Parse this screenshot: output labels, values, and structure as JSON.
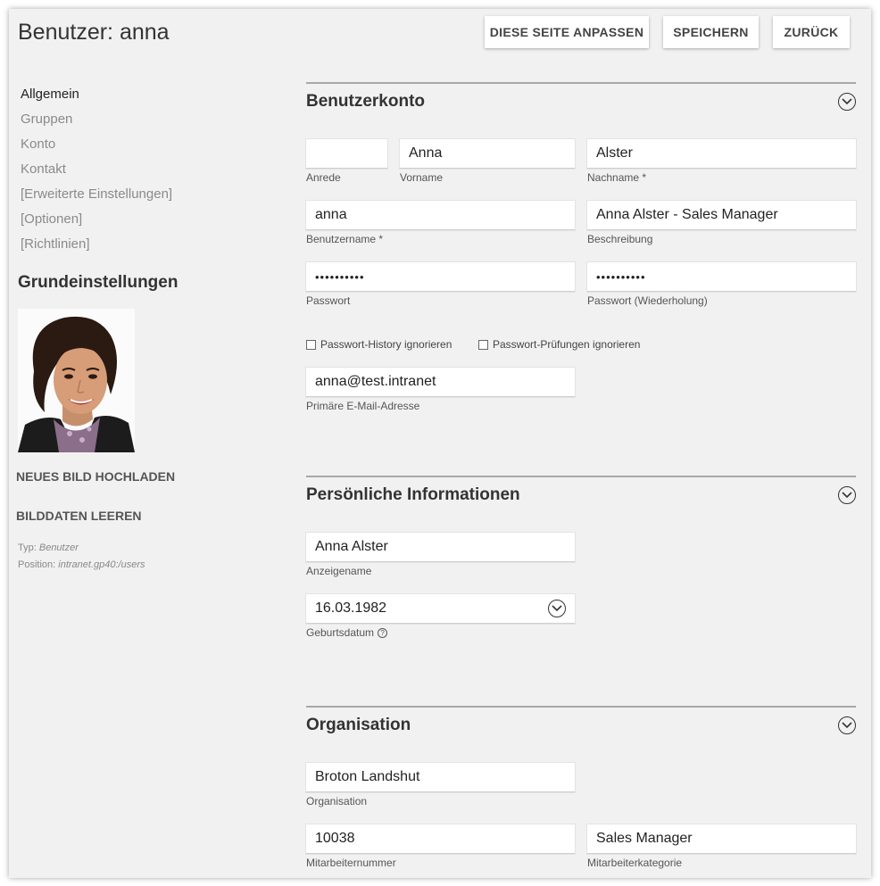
{
  "header": {
    "title": "Benutzer: anna",
    "buttons": {
      "customize": "Diese Seite anpassen",
      "save": "Speichern",
      "back": "Zurück"
    }
  },
  "sidebar": {
    "items": [
      {
        "label": "Allgemein",
        "active": true
      },
      {
        "label": "Gruppen"
      },
      {
        "label": "Konto"
      },
      {
        "label": "Kontakt"
      },
      {
        "label": "[Erweiterte Einstellungen]"
      },
      {
        "label": "[Optionen]"
      },
      {
        "label": "[Richtlinien]"
      }
    ],
    "section_title": "Grundeinstellungen",
    "upload_label": "Neues Bild hochladen",
    "clear_label": "Bilddaten leeren",
    "type_label": "Typ:",
    "type_value": "Benutzer",
    "position_label": "Position:",
    "position_value": "intranet.gp40:/users"
  },
  "account": {
    "title": "Benutzerkonto",
    "salutation": {
      "value": "",
      "label": "Anrede"
    },
    "first_name": {
      "value": "Anna",
      "label": "Vorname"
    },
    "last_name": {
      "value": "Alster",
      "label": "Nachname *"
    },
    "username": {
      "value": "anna",
      "label": "Benutzername *"
    },
    "description": {
      "value": "Anna Alster - Sales Manager",
      "label": "Beschreibung"
    },
    "password": {
      "value": "••••••••••",
      "label": "Passwort"
    },
    "password_repeat": {
      "value": "••••••••••",
      "label": "Passwort (Wiederholung)"
    },
    "ignore_history": "Passwort-History ignorieren",
    "ignore_checks": "Passwort-Prüfungen ignorieren",
    "email": {
      "value": "anna@test.intranet",
      "label": "Primäre E-Mail-Adresse"
    }
  },
  "personal": {
    "title": "Persönliche Informationen",
    "display_name": {
      "value": "Anna Alster",
      "label": "Anzeigename"
    },
    "birthdate": {
      "value": "16.03.1982",
      "label": "Geburtsdatum"
    }
  },
  "organisation": {
    "title": "Organisation",
    "organisation": {
      "value": "Broton Landshut",
      "label": "Organisation"
    },
    "employee_number": {
      "value": "10038",
      "label": "Mitarbeiternummer"
    },
    "employee_category": {
      "value": "Sales Manager",
      "label": "Mitarbeiterkategorie"
    }
  },
  "icons": {
    "collapse": "chevron-down-circle-icon",
    "date": "chevron-down-circle-icon",
    "help": "question-circle-icon"
  }
}
